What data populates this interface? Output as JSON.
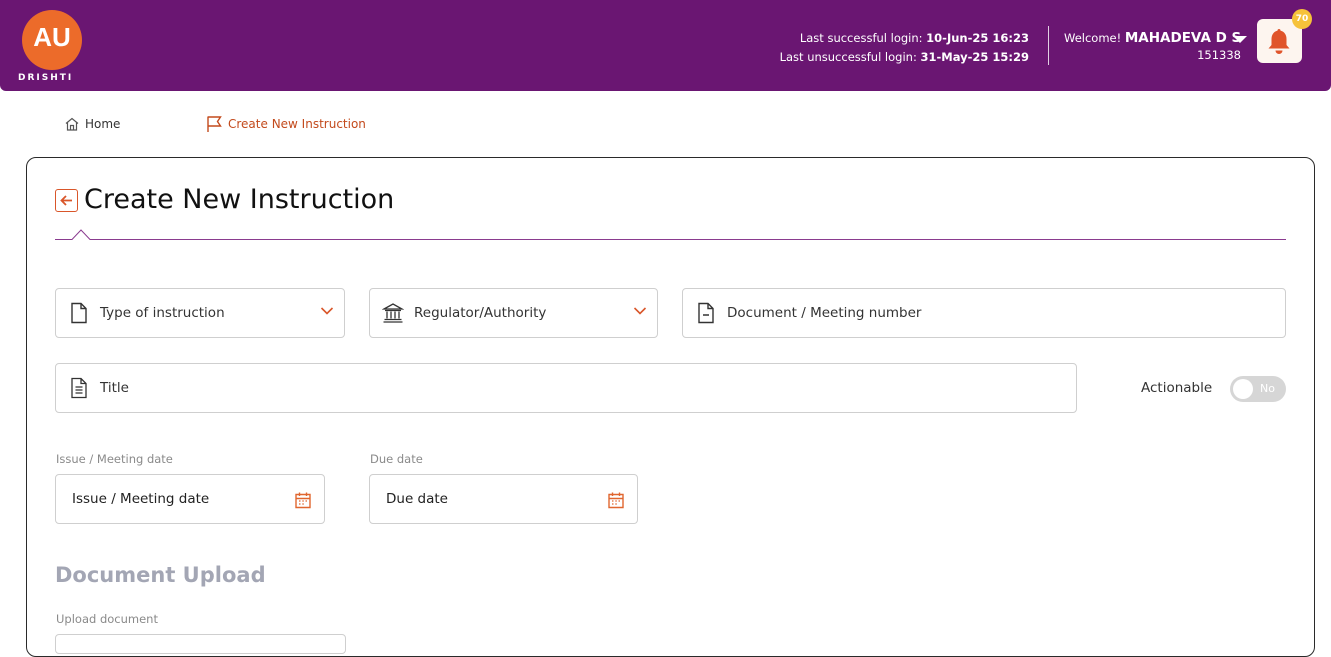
{
  "header": {
    "logo_text": "AU",
    "logo_sub": "DRISHTI",
    "last_success_label": "Last successful login:",
    "last_success_value": "10-Jun-25 16:23",
    "last_fail_label": "Last unsuccessful login:",
    "last_fail_value": "31-May-25 15:29",
    "welcome_label": "Welcome!",
    "user_name": "MAHADEVA D S",
    "user_id": "151338",
    "notification_count": "70",
    "brand_color": "#6a1672",
    "accent_color": "#ec6b2a"
  },
  "breadcrumb": {
    "home": "Home",
    "current": "Create New Instruction"
  },
  "page": {
    "title": "Create New Instruction"
  },
  "form": {
    "type_of_instruction": "Type of instruction",
    "regulator": "Regulator/Authority",
    "document_number": "Document / Meeting number",
    "title": "Title",
    "actionable_label": "Actionable",
    "actionable_value": "No",
    "issue_date_label": "Issue / Meeting date",
    "issue_date_placeholder": "Issue / Meeting date",
    "due_date_label": "Due date",
    "due_date_placeholder": "Due date",
    "upload_section_title": "Document Upload",
    "upload_label": "Upload document"
  },
  "icons": {
    "home": "home-icon",
    "flag": "flag-icon",
    "back": "back-arrow-icon",
    "document": "document-icon",
    "bank": "bank-icon",
    "calendar": "calendar-icon",
    "bell": "bell-icon",
    "chevron": "chevron-down-icon"
  }
}
